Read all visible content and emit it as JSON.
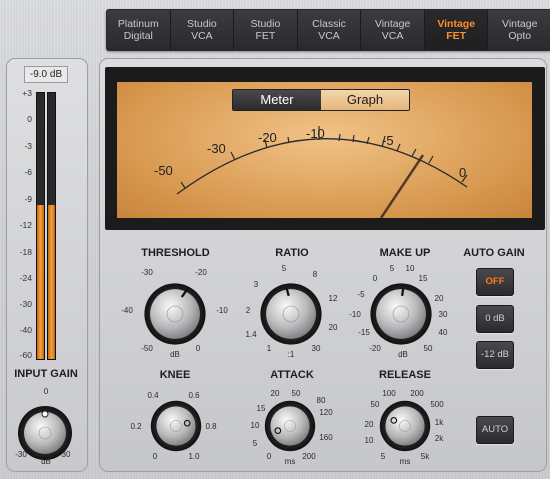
{
  "tabs": [
    {
      "label": "Platinum\nDigital",
      "active": false
    },
    {
      "label": "Studio\nVCA",
      "active": false
    },
    {
      "label": "Studio\nFET",
      "active": false
    },
    {
      "label": "Classic\nVCA",
      "active": false
    },
    {
      "label": "Vintage\nVCA",
      "active": false
    },
    {
      "label": "Vintage\nFET",
      "active": true
    },
    {
      "label": "Vintage\nOpto",
      "active": false
    }
  ],
  "input": {
    "level": "-9.0 dB",
    "scale": [
      "+3",
      "0",
      "-3",
      "-6",
      "-9",
      "-12",
      "-18",
      "-24",
      "-30",
      "-40",
      "-60"
    ],
    "meter_level_fraction": 0.58,
    "gain_title": "INPUT GAIN",
    "gain_labels": {
      "top": "0",
      "left": "-30",
      "right": "30",
      "unit": "dB"
    }
  },
  "meter": {
    "tabs": {
      "meter": "Meter",
      "graph": "Graph",
      "selected": "Meter"
    },
    "scale": [
      "-50",
      "-30",
      "-20",
      "-10",
      "-5",
      "0"
    ],
    "needle_value": "-2"
  },
  "knobs": {
    "threshold": {
      "title": "THRESHOLD",
      "labels": [
        "-30",
        "-20",
        "-40",
        "-10",
        "-50",
        "0"
      ],
      "unit": "dB"
    },
    "ratio": {
      "title": "RATIO",
      "labels": [
        "5",
        "8",
        "3",
        "12",
        "2",
        "20",
        "1.4",
        "30",
        "1"
      ],
      "unit": ":1"
    },
    "makeup": {
      "title": "MAKE UP",
      "labels": [
        "0",
        "5",
        "10",
        "15",
        "-5",
        "20",
        "-10",
        "30",
        "-15",
        "40",
        "-20",
        "50"
      ],
      "unit": "dB"
    },
    "knee": {
      "title": "KNEE",
      "labels": [
        "0.4",
        "0.6",
        "0.2",
        "0.8",
        "0",
        "1.0"
      ]
    },
    "attack": {
      "title": "ATTACK",
      "labels": [
        "20",
        "50",
        "15",
        "80",
        "10",
        "120",
        "5",
        "160",
        "0",
        "200"
      ],
      "unit": "ms"
    },
    "release": {
      "title": "RELEASE",
      "labels": [
        "100",
        "200",
        "50",
        "500",
        "20",
        "1k",
        "10",
        "2k",
        "5",
        "5k"
      ],
      "unit": "ms"
    }
  },
  "auto_gain": {
    "title": "AUTO GAIN",
    "buttons": [
      {
        "label": "OFF",
        "on": true
      },
      {
        "label": "0 dB",
        "on": false
      },
      {
        "label": "-12 dB",
        "on": false
      }
    ],
    "auto_label": "AUTO"
  },
  "colors": {
    "accent": "#ff7a1e",
    "meter_fill": "#f6a23a"
  }
}
